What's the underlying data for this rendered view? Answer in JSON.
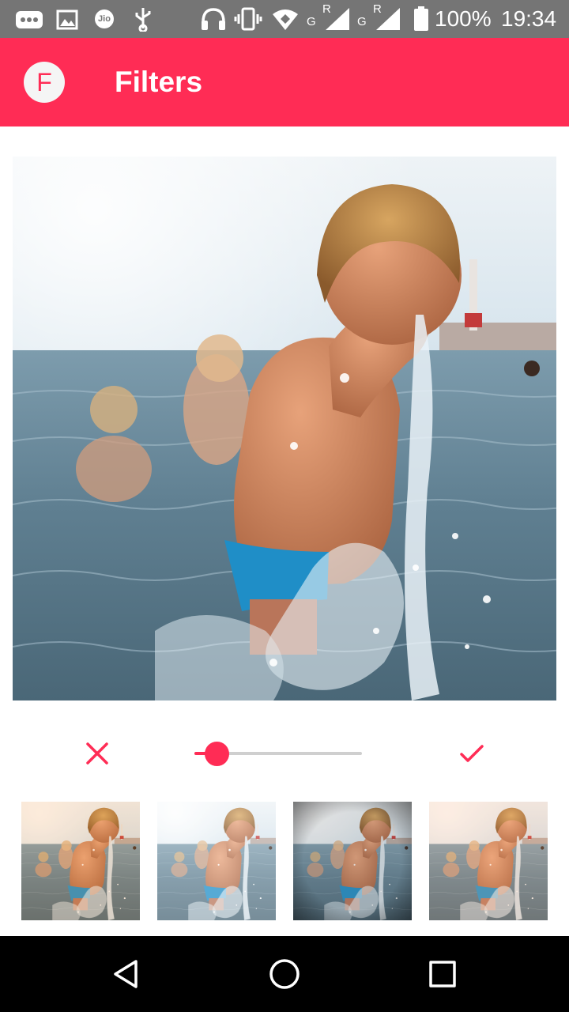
{
  "status_bar": {
    "battery_percent": "100%",
    "time": "19:34",
    "network_label_1": "G",
    "network_label_2": "G",
    "roaming_label_1": "R",
    "roaming_label_2": "R",
    "carrier_badge": "Jio",
    "icons": [
      "messages-icon",
      "gallery-icon",
      "jio-icon",
      "usb-icon",
      "headset-icon",
      "vibrate-icon",
      "wifi-hotspot-icon",
      "signal-icon",
      "signal-icon",
      "battery-icon"
    ]
  },
  "app_bar": {
    "avatar_letter": "F",
    "title": "Filters",
    "color": "#ff2c55"
  },
  "editor": {
    "cancel_icon": "close-icon",
    "confirm_icon": "check-icon",
    "intensity_fraction": 0.07,
    "accent_color": "#ff2c55"
  },
  "thumbnails": [
    {
      "filter": "warm"
    },
    {
      "filter": "bright"
    },
    {
      "filter": "vignette"
    },
    {
      "filter": "vivid"
    }
  ],
  "nav_bar": {
    "icons": [
      "back-icon",
      "home-icon",
      "recents-icon"
    ]
  }
}
